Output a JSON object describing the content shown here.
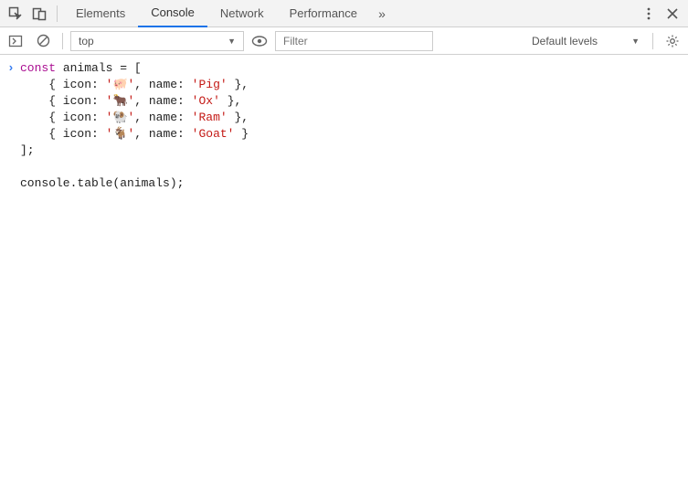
{
  "tabbar": {
    "tabs": [
      "Elements",
      "Console",
      "Network",
      "Performance"
    ],
    "activeIndex": 1,
    "moreGlyph": "»"
  },
  "toolbar": {
    "context": "top",
    "filterPlaceholder": "Filter",
    "levels": "Default levels"
  },
  "code": {
    "animals": [
      {
        "icon": "🐖",
        "name": "Pig"
      },
      {
        "icon": "🐂",
        "name": "Ox"
      },
      {
        "icon": "🐏",
        "name": "Ram"
      },
      {
        "icon": "🐐",
        "name": "Goat"
      }
    ],
    "declLine": "const animals = [",
    "closeLine": "];",
    "call": "console.table(animals);"
  }
}
